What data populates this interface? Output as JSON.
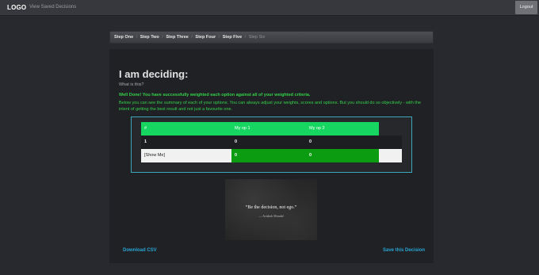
{
  "navbar": {
    "logo": "LOGO",
    "saved_link": "View Saved Decisions",
    "logout": "Logout"
  },
  "breadcrumb": {
    "items": [
      "Step One",
      "Step Two",
      "Step Three",
      "Step Four",
      "Step Five",
      "Step Six"
    ],
    "separator": "/"
  },
  "main": {
    "heading": "I am deciding:",
    "subheading": "What is this?",
    "success_title": "Well Done! You have successfully weighted each option against all of your weighted criteria.",
    "success_body": "Below you can see the summary of each of your options. You can always adjust your weights, scores and options. But you should do so objectively - with the intent of getting the best result and not just a favourite one.",
    "table": {
      "headers": [
        "#",
        "My op 1",
        "My op 2"
      ],
      "rows": [
        [
          "1",
          "0",
          "0"
        ],
        [
          "[Show Me]",
          "0",
          "0"
        ]
      ]
    },
    "quote": {
      "text": "“Be the decision, not ego.”",
      "author": "— Avishek Mondal"
    },
    "download_link": "Download CSV",
    "save_link": "Save this Decision"
  },
  "colors": {
    "accent_green": "#16d661",
    "highlight_green": "#0c9c12",
    "message_green": "#35d14a",
    "link_blue": "#2aa6d6",
    "table_border": "#3ea6b8"
  }
}
